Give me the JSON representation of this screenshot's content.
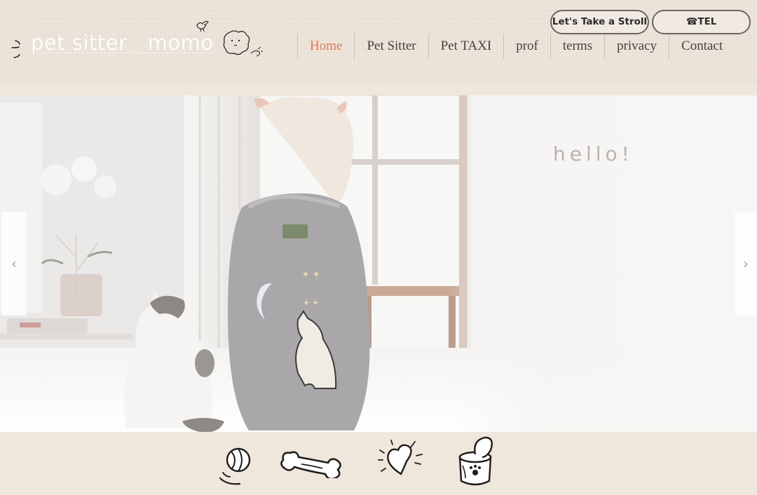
{
  "site": {
    "logo_text": "pet sitter   momo"
  },
  "nav": {
    "items": [
      {
        "label": "Home",
        "active": true
      },
      {
        "label": "Pet Sitter",
        "active": false
      },
      {
        "label": "Pet TAXI",
        "active": false
      },
      {
        "label": "prof",
        "active": false
      },
      {
        "label": "terms",
        "active": false
      },
      {
        "label": "privacy",
        "active": false
      },
      {
        "label": "Contact",
        "active": false
      }
    ]
  },
  "buttons": {
    "stroll_label": "Let's Take a Stroll",
    "tel_label": "☎TEL"
  },
  "hero": {
    "heading": "hello!",
    "prev_icon": "‹",
    "next_icon": "›"
  },
  "colors": {
    "background": "#efe6dc",
    "nav_active": "#e07a5a",
    "nav_text": "#4a3f3a"
  },
  "icons": [
    "ball-icon",
    "bone-icon",
    "heart-icon",
    "pet-food-can-icon"
  ]
}
